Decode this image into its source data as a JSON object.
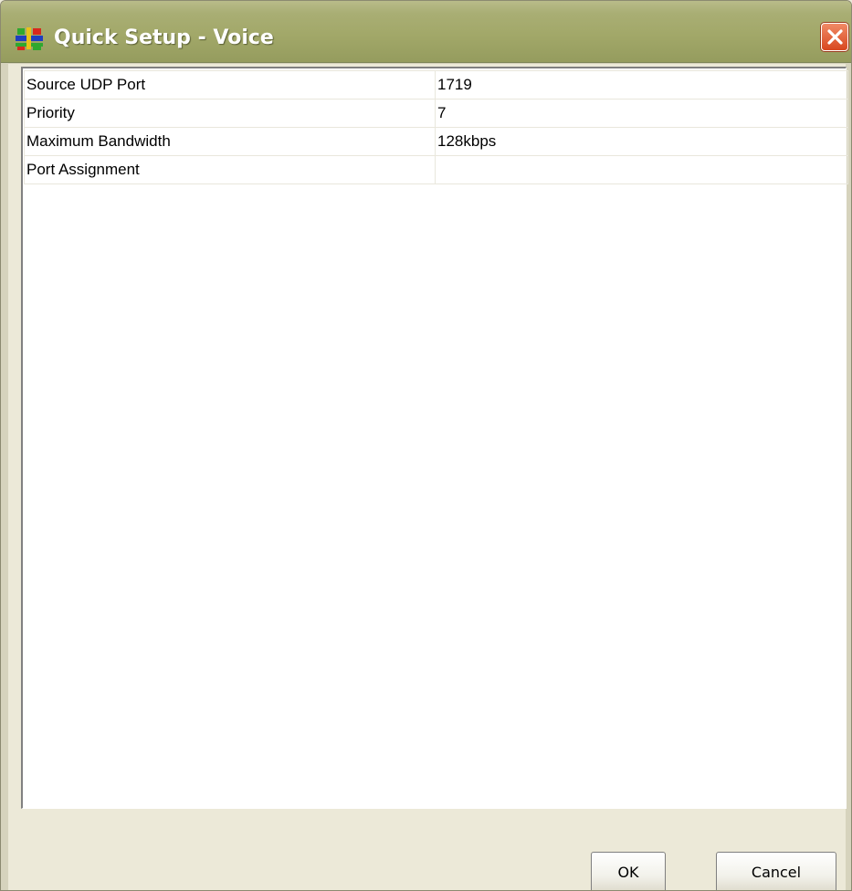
{
  "window": {
    "title": "Quick Setup - Voice"
  },
  "properties": [
    {
      "name": "Source UDP Port",
      "value": "1719"
    },
    {
      "name": "Priority",
      "value": "7"
    },
    {
      "name": "Maximum Bandwidth",
      "value": "128kbps"
    },
    {
      "name": "Port Assignment",
      "value": ""
    }
  ],
  "buttons": {
    "ok_label": "OK",
    "cancel_label": "Cancel"
  },
  "icons": {
    "app": "network-app-icon",
    "close": "close-icon"
  },
  "colors": {
    "titlebar": "#a2a869",
    "close_button": "#d8471f",
    "dialog_background": "#ece9d8"
  }
}
